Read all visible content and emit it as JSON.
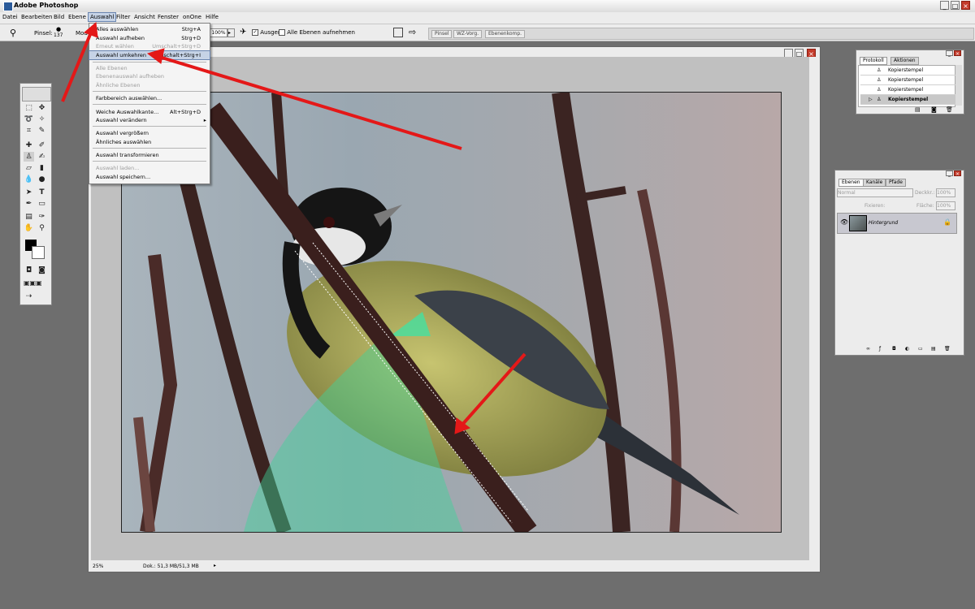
{
  "app": {
    "title": "Adobe Photoshop"
  },
  "menubar": {
    "items": [
      "Datei",
      "Bearbeiten",
      "Bild",
      "Ebene",
      "Auswahl",
      "Filter",
      "Ansicht",
      "Fenster",
      "onOne",
      "Hilfe"
    ],
    "active": "Auswahl"
  },
  "options": {
    "brush_label": "Pinsel:",
    "brush_size": "137",
    "mode_label": "Mod",
    "zoom": "100%",
    "aligned_label": "Ausger.",
    "all_layers_label": "Alle Ebenen aufnehmen"
  },
  "palette_well": {
    "tabs": [
      "Pinsel",
      "WZ-Vorg.",
      "Ebenenkomp."
    ]
  },
  "menu": {
    "items": [
      {
        "label": "Alles auswählen",
        "shortcut": "Strg+A",
        "disabled": false
      },
      {
        "label": "Auswahl aufheben",
        "shortcut": "Strg+D",
        "disabled": false
      },
      {
        "label": "Erneut wählen",
        "shortcut": "Umschalt+Strg+D",
        "disabled": true
      },
      {
        "label": "Auswahl umkehren",
        "shortcut": "Umschalt+Strg+I",
        "disabled": false,
        "highlighted": true
      },
      {
        "label": "Alle Ebenen",
        "shortcut": "",
        "disabled": true
      },
      {
        "label": "Ebenenauswahl aufheben",
        "shortcut": "",
        "disabled": true
      },
      {
        "label": "Ähnliche Ebenen",
        "shortcut": "",
        "disabled": true
      },
      {
        "label": "Farbbereich auswählen...",
        "shortcut": "",
        "disabled": false
      },
      {
        "label": "Weiche Auswahlkante...",
        "shortcut": "Alt+Strg+D",
        "disabled": false
      },
      {
        "label": "Auswahl verändern",
        "shortcut": "▸",
        "disabled": false
      },
      {
        "label": "Auswahl vergrößern",
        "shortcut": "",
        "disabled": false
      },
      {
        "label": "Ähnliches auswählen",
        "shortcut": "",
        "disabled": false
      },
      {
        "label": "Auswahl transformieren",
        "shortcut": "",
        "disabled": false
      },
      {
        "label": "Auswahl laden...",
        "shortcut": "",
        "disabled": true
      },
      {
        "label": "Auswahl speichern...",
        "shortcut": "",
        "disabled": false
      }
    ]
  },
  "status": {
    "zoom": "25%",
    "doc": "Dok.: 51,3 MB/51,3 MB"
  },
  "protokoll": {
    "tabs": [
      "Protokoll",
      "Aktionen"
    ],
    "items": [
      "Kopierstempel",
      "Kopierstempel",
      "Kopierstempel",
      "Kopierstempel"
    ]
  },
  "ebenen": {
    "tabs": [
      "Ebenen",
      "Kanäle",
      "Pfade"
    ],
    "blend": "Normal",
    "opacity_label": "Deckkr.:",
    "opacity": "100%",
    "lock_label": "Fixieren:",
    "fill_label": "Fläche:",
    "fill": "100%",
    "layer": "Hintergrund"
  },
  "colors": {
    "accent_red": "#e41818",
    "menu_highlight": "#c6d3e6"
  },
  "icons": [
    "app-icon",
    "clone-stamp-icon",
    "eye-icon",
    "lock-icon",
    "arrow-annotation"
  ]
}
